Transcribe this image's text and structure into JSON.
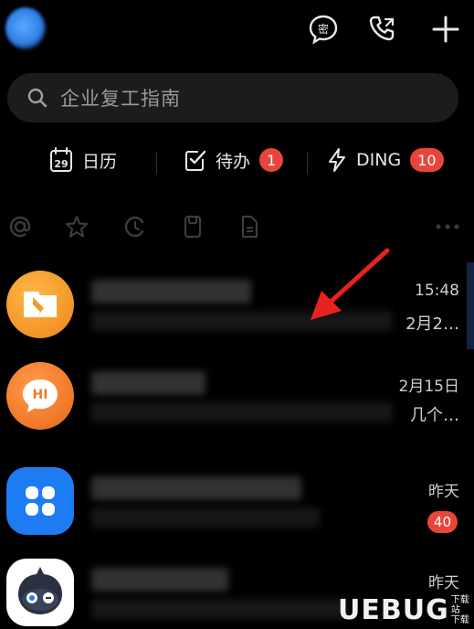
{
  "header": {
    "icons": [
      "user-avatar",
      "secret-chat-icon",
      "phone-call-icon",
      "add-icon"
    ],
    "secret_glyph": "密"
  },
  "search": {
    "placeholder": "企业复工指南"
  },
  "quick_actions": [
    {
      "label": "日历",
      "icon": "calendar-icon",
      "calendar_day": "29"
    },
    {
      "label": "待办",
      "icon": "todo-check-icon",
      "badge": "1"
    },
    {
      "label": "DING",
      "icon": "lightning-icon",
      "badge": "10"
    }
  ],
  "filters": [
    "at-icon",
    "star-icon",
    "clock-icon",
    "bookmark-icon",
    "document-icon",
    "more-icon"
  ],
  "chats": [
    {
      "time": "15:48",
      "tail": "2月2…",
      "avatar_color": "#f39a2a"
    },
    {
      "time": "2月15日",
      "tail": "几个…",
      "avatar_color": "#f07a2a",
      "avatar_text": "HI"
    },
    {
      "time": "昨天",
      "badge": "40",
      "avatar_color": "#1e7cf2"
    },
    {
      "time": "昨天",
      "avatar_color": "#ffffff"
    }
  ],
  "watermark": {
    "text": "UEBUG",
    "small_top": "下载站",
    "small_bottom": "下载"
  },
  "colors": {
    "background": "#000000",
    "badge": "#e8463a",
    "search_bg": "#1c1c1e",
    "annotation_arrow": "#e8221f"
  }
}
